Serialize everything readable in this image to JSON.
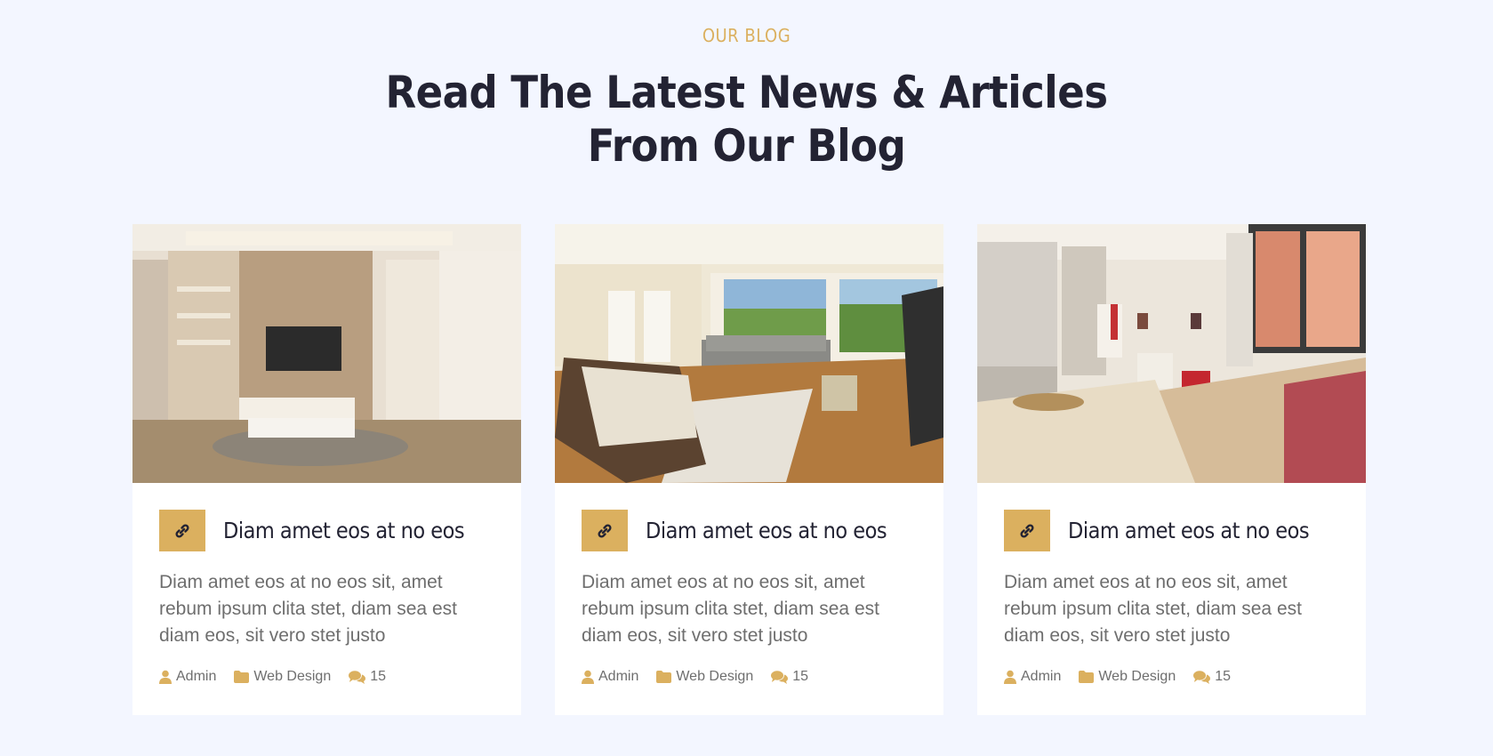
{
  "section": {
    "eyebrow": "OUR BLOG",
    "headline_line1": "Read The Latest News & Articles",
    "headline_line2": "From Our Blog"
  },
  "colors": {
    "accent": "#dbb05f",
    "background": "#f3f6ff",
    "heading": "#232333",
    "body_text": "#6e6e6e"
  },
  "posts": [
    {
      "image": "living-room-tv-wall-photo",
      "icon": "link-icon",
      "title": "Diam amet eos at no eos",
      "excerpt": "Diam amet eos at no eos sit, amet rebum ipsum clita stet, diam sea est diam eos, sit vero stet justo",
      "author": "Admin",
      "category": "Web Design",
      "comments": "15"
    },
    {
      "image": "bright-living-room-windows-photo",
      "icon": "link-icon",
      "title": "Diam amet eos at no eos",
      "excerpt": "Diam amet eos at no eos sit, amet rebum ipsum clita stet, diam sea est diam eos, sit vero stet justo",
      "author": "Admin",
      "category": "Web Design",
      "comments": "15"
    },
    {
      "image": "open-kitchen-dining-room-photo",
      "icon": "link-icon",
      "title": "Diam amet eos at no eos",
      "excerpt": "Diam amet eos at no eos sit, amet rebum ipsum clita stet, diam sea est diam eos, sit vero stet justo",
      "author": "Admin",
      "category": "Web Design",
      "comments": "15"
    }
  ]
}
